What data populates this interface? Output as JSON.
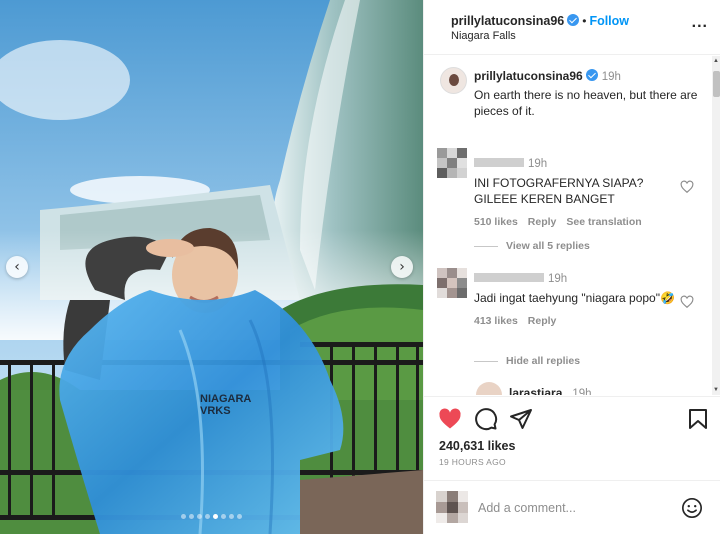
{
  "post": {
    "username": "prillylatuconsina96",
    "follow_label": "Follow",
    "separator": "•",
    "location": "Niagara Falls",
    "more_label": "...",
    "caption": "On earth there is no heaven, but there are pieces of it.",
    "caption_time": "19h"
  },
  "carousel": {
    "prev_label": "‹",
    "next_label": "›",
    "dot_count": 8,
    "active_dot": 5,
    "poncho_text": "NIAGARA\nVRKS"
  },
  "comments": [
    {
      "time": "19h",
      "text": "INI FOTOGRAFERNYA SIAPA? GILEEE KEREN BANGET",
      "likes": "510 likes",
      "reply_label": "Reply",
      "translate_label": "See translation",
      "replies_toggle": "View all 5 replies"
    },
    {
      "time": "19h",
      "text": "Jadi ingat taehyung \"niagara popo\"🤣",
      "likes": "413 likes",
      "reply_label": "Reply",
      "replies_toggle": "Hide all replies"
    },
    {
      "username": "larastiara",
      "time": "19h"
    }
  ],
  "actions": {
    "likes_count": "240,631 likes",
    "time_ago": "19 HOURS AGO"
  },
  "add_comment": {
    "placeholder": "Add a comment..."
  },
  "colors": {
    "like_red": "#ed4956",
    "link_blue": "#0095f6",
    "verified_blue": "#3897f0",
    "poncho_blue": "#3aa0e6"
  }
}
